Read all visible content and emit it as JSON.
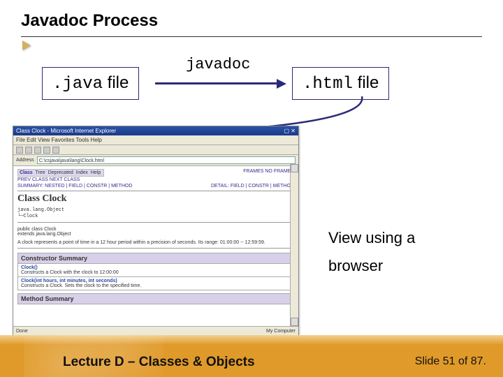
{
  "slide": {
    "title": "Javadoc Process",
    "flow": {
      "source_box": ".java file",
      "source_mono": ".java",
      "source_rest": " file",
      "converter_label": "javadoc",
      "target_box": ".html file",
      "target_mono": ".html",
      "target_rest": " file"
    },
    "view_line1": "View using a",
    "view_line2": "browser",
    "footer": {
      "lecture": "Lecture D – Classes & Objects",
      "slide_indicator": "Slide 51 of 87."
    }
  },
  "screenshot": {
    "window_title": "Class Clock - Microsoft Internet Explorer",
    "menu": "File  Edit  View  Favorites  Tools  Help",
    "address_label": "Address",
    "address_value": "C:\\csjava\\java\\lang\\Clock.html",
    "nav_tabs": [
      "Class",
      "Tree",
      "Deprecated",
      "Index",
      "Help"
    ],
    "nav_right": [
      "FRAMES",
      "NO FRAMES"
    ],
    "nav_prev_next": "PREV CLASS  NEXT CLASS",
    "nav_summary": "SUMMARY: NESTED | FIELD | CONSTR | METHOD",
    "nav_detail": "DETAIL: FIELD | CONSTR | METHOD",
    "class_heading": "Class Clock",
    "hierarchy_line1": "java.lang.Object",
    "hierarchy_line2": "  └─Clock",
    "signature_line1": "public class Clock",
    "signature_line2": "extends java.lang.Object",
    "description": "A clock represents a point of time in a 12 hour period within a precision of seconds. Its range: 01:00:00 -- 12:59:59.",
    "constructor_header": "Constructor Summary",
    "constructors": [
      {
        "sig": "Clock()",
        "desc": "Constructs a Clock with the clock to 12:00:00"
      },
      {
        "sig": "Clock(int hours, int minutes, int seconds)",
        "desc": "Constructs a Clock. Sets the clock to the specified time."
      }
    ],
    "method_header": "Method Summary",
    "status_left": "Done",
    "status_right": "My Computer"
  }
}
